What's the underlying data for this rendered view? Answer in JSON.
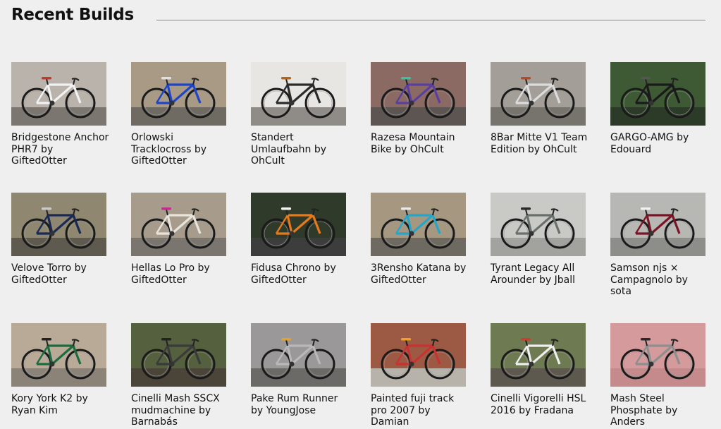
{
  "section": {
    "title": "Recent Builds"
  },
  "builds": [
    {
      "title": "Bridgestone Anchor PHR7 by GiftedOtter",
      "bg": "#b9b3ab",
      "ground": "#7c7670",
      "frame": "#f2f2f2",
      "accent": "#c0392b"
    },
    {
      "title": "Orlowski Tracklocross by GiftedOtter",
      "bg": "#a89a84",
      "ground": "#6f6a62",
      "frame": "#1e45c8",
      "accent": "#e0e0e0"
    },
    {
      "title": "Standert Umlaufbahn by OhCult",
      "bg": "#e8e6e2",
      "ground": "#8f8c88",
      "frame": "#2b2b2b",
      "accent": "#b5651d"
    },
    {
      "title": "Razesa Mountain Bike by OhCult",
      "bg": "#8c6a64",
      "ground": "#5c5552",
      "frame": "#5a3fa0",
      "accent": "#3cc0a0"
    },
    {
      "title": "8Bar Mitte V1 Team Edition by OhCult",
      "bg": "#a39f98",
      "ground": "#77736d",
      "frame": "#dcdcdc",
      "accent": "#b54b2a"
    },
    {
      "title": "GARGO-AMG by Edouard",
      "bg": "#3d5a35",
      "ground": "#2c3a28",
      "frame": "#1a1a1a",
      "accent": "#555555"
    },
    {
      "title": "Velove Torro by GiftedOtter",
      "bg": "#8f8770",
      "ground": "#5f5a50",
      "frame": "#1b2a55",
      "accent": "#c9c9c9"
    },
    {
      "title": "Hellas Lo Pro by GiftedOtter",
      "bg": "#a79c8c",
      "ground": "#7a756f",
      "frame": "#e8e4dc",
      "accent": "#c02f8c"
    },
    {
      "title": "Fidusa Chrono by GiftedOtter",
      "bg": "#2f3a2a",
      "ground": "#3d3d3d",
      "frame": "#e57a1c",
      "accent": "#f4f4f4"
    },
    {
      "title": "3Rensho Katana by GiftedOtter",
      "bg": "#a59780",
      "ground": "#6e6a62",
      "frame": "#25a6c9",
      "accent": "#e8e8e8"
    },
    {
      "title": "Tyrant Legacy All Arounder by Jball",
      "bg": "#c9cac6",
      "ground": "#a2a29e",
      "frame": "#6b6f6a",
      "accent": "#2a2a2a"
    },
    {
      "title": "Samson njs × Campagnolo by sota",
      "bg": "#b7b8b4",
      "ground": "#8d8d8a",
      "frame": "#7a1426",
      "accent": "#f1f1f1"
    },
    {
      "title": "Kory York K2 by Ryan Kim",
      "bg": "#b9aa98",
      "ground": "#8b8378",
      "frame": "#1d6a3f",
      "accent": "#222222"
    },
    {
      "title": "Cinelli Mash SSCX mudmachine by Barnabás",
      "bg": "#55603e",
      "ground": "#4a4538",
      "frame": "#3a3a3a",
      "accent": "#222222"
    },
    {
      "title": "Pake Rum Runner by YoungJose",
      "bg": "#9a9898",
      "ground": "#6c6a66",
      "frame": "#b9b9b9",
      "accent": "#e3a32a"
    },
    {
      "title": "Painted fuji track pro 2007 by Damian",
      "bg": "#9c5a44",
      "ground": "#b8b3aa",
      "frame": "#c83232",
      "accent": "#f0a020"
    },
    {
      "title": "Cinelli Vigorelli HSL 2016 by Fradana",
      "bg": "#6e7a52",
      "ground": "#5e594e",
      "frame": "#eeeeee",
      "accent": "#d23a2a"
    },
    {
      "title": "Mash Steel Phosphate by Anders",
      "bg": "#d49a9c",
      "ground": "#c48a8c",
      "frame": "#8e8e8e",
      "accent": "#2a2a2a"
    }
  ]
}
